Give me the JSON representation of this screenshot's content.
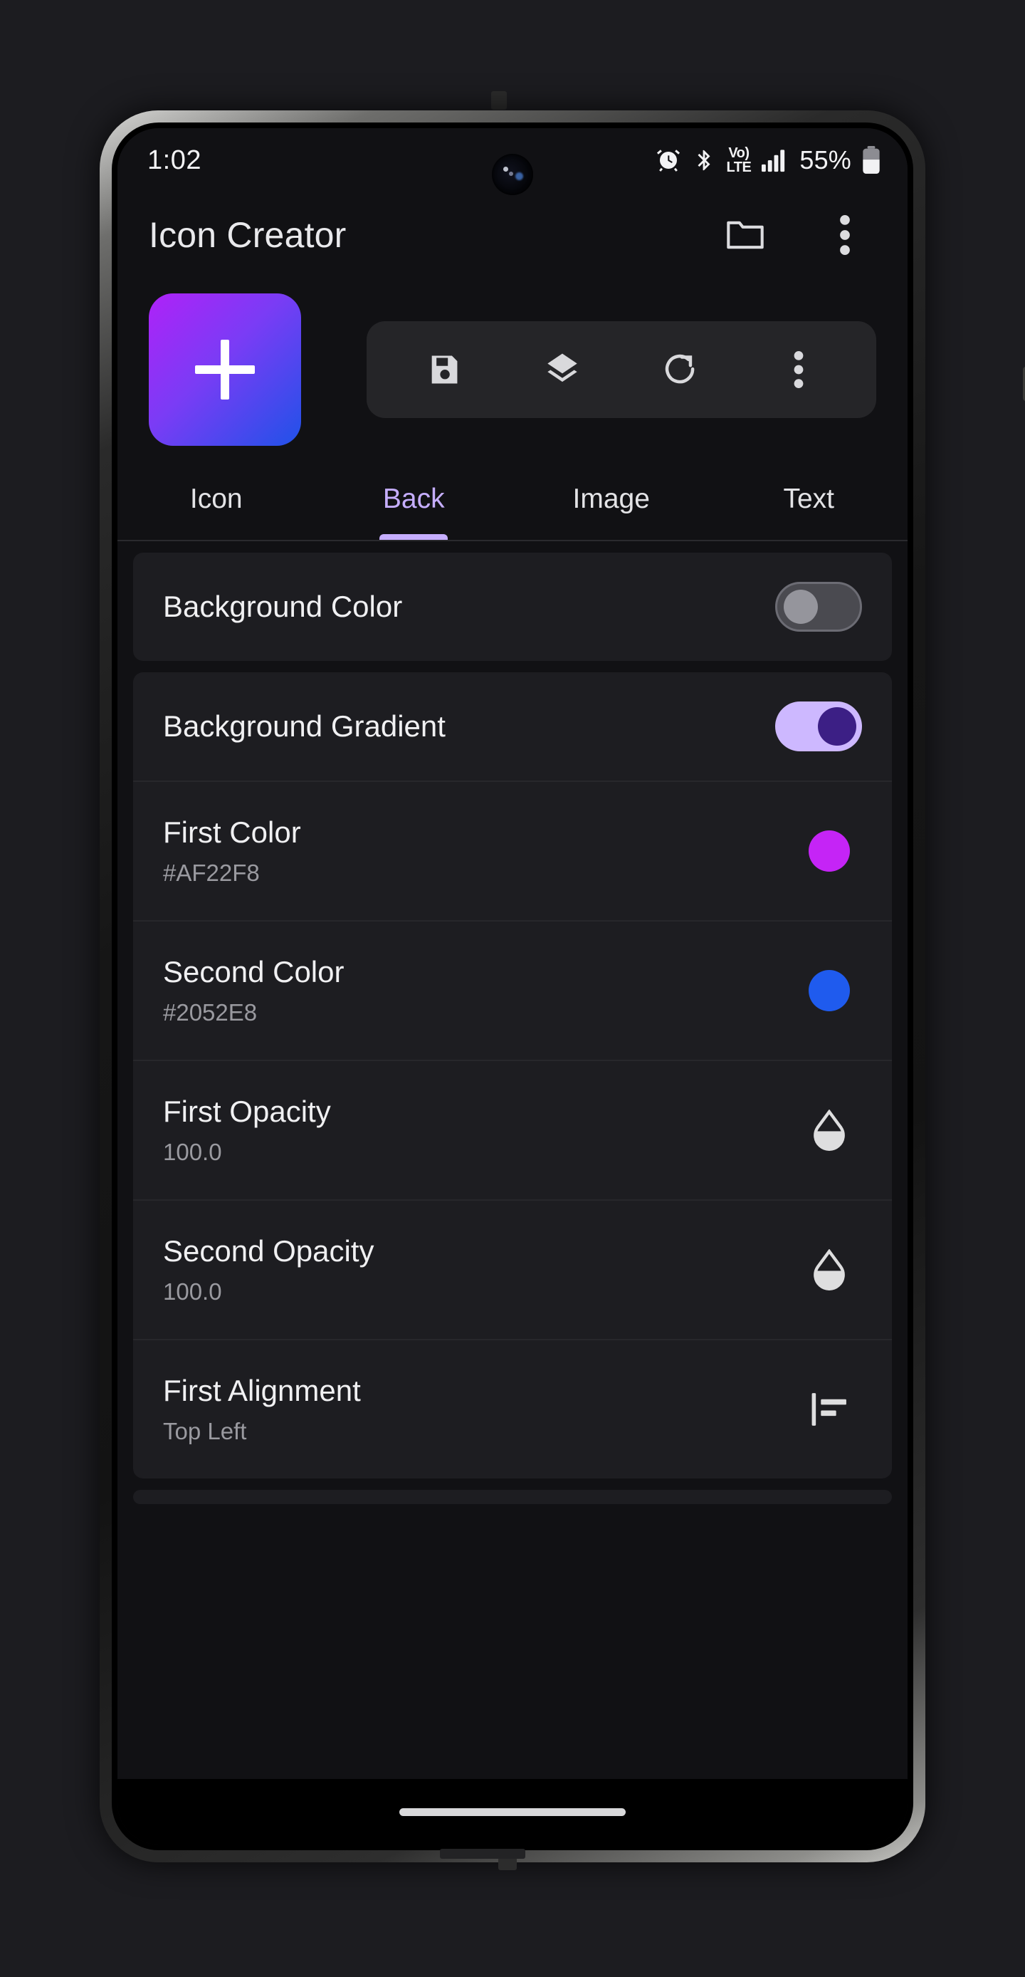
{
  "statusbar": {
    "time": "1:02",
    "battery_percent": "55%",
    "volte_top": "Vo)",
    "volte_bottom": "LTE",
    "icons": [
      "alarm-icon",
      "bluetooth-icon",
      "volte-icon",
      "signal-icon",
      "battery-icon"
    ]
  },
  "appbar": {
    "title": "Icon Creator",
    "actions": [
      {
        "name": "folder-icon"
      },
      {
        "name": "overflow-menu-icon"
      }
    ]
  },
  "preview": {
    "tile_icon": "plus-icon",
    "gradient_start": "#AF22F8",
    "gradient_end": "#2052E8",
    "toolbar": [
      {
        "name": "save-icon"
      },
      {
        "name": "layers-icon"
      },
      {
        "name": "redo-icon"
      },
      {
        "name": "overflow-menu-icon"
      }
    ]
  },
  "tabs": {
    "items": [
      {
        "label": "Icon",
        "active": false
      },
      {
        "label": "Back",
        "active": true
      },
      {
        "label": "Image",
        "active": false
      },
      {
        "label": "Text",
        "active": false
      }
    ],
    "active_color": "#C6AEFF"
  },
  "settings": {
    "background_color": {
      "label": "Background Color",
      "toggle": "off"
    },
    "background_gradient": {
      "label": "Background Gradient",
      "toggle": "on"
    },
    "rows": [
      {
        "title": "First Color",
        "value": "#AF22F8",
        "trailing": "color-swatch",
        "swatch_color": "#C524F6"
      },
      {
        "title": "Second Color",
        "value": "#2052E8",
        "trailing": "color-swatch",
        "swatch_color": "#1F5BEE"
      },
      {
        "title": "First Opacity",
        "value": "100.0",
        "trailing": "opacity-droplet-icon"
      },
      {
        "title": "Second Opacity",
        "value": "100.0",
        "trailing": "opacity-droplet-icon"
      },
      {
        "title": "First Alignment",
        "value": "Top Left",
        "trailing": "align-top-left-icon"
      }
    ]
  },
  "navbar": {
    "handle": "home-gesture-pill"
  }
}
